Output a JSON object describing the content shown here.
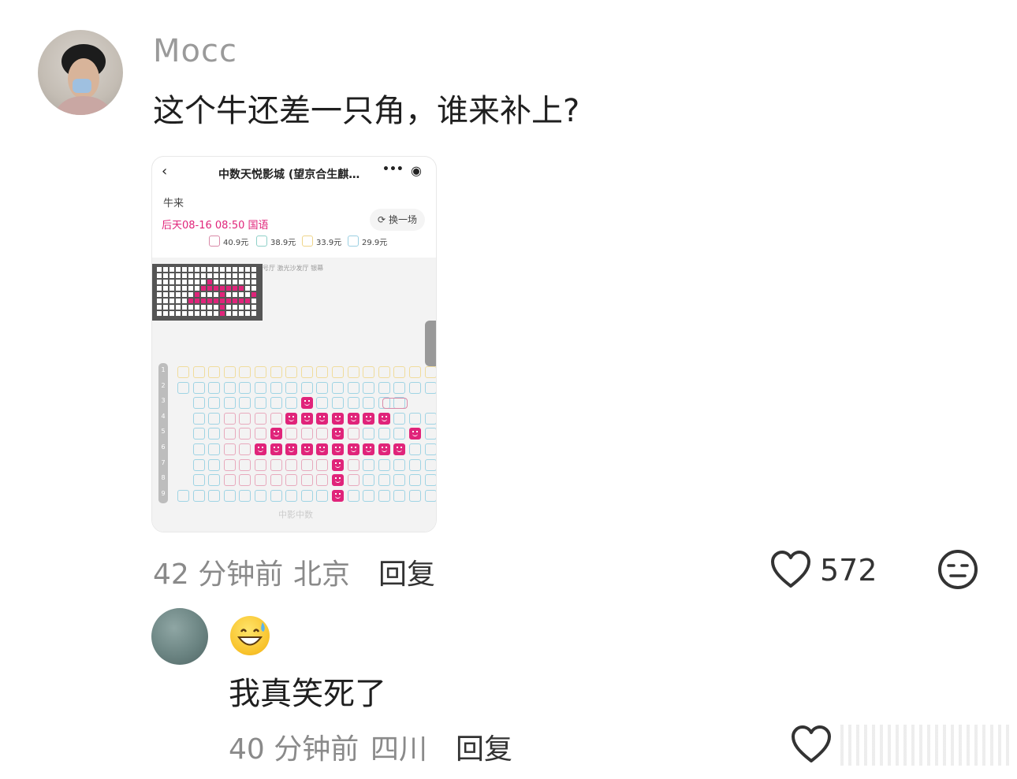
{
  "comment1": {
    "username": "Mocc",
    "text": "这个牛还差一只角，谁来补上?",
    "time": "42 分钟前",
    "location": "北京",
    "reply_label": "回复",
    "like_count": "572",
    "icons": [
      "avatar",
      "heart-icon",
      "meh-face-icon"
    ]
  },
  "screenshot": {
    "nav_title": "中数天悦影城 (望京合生麒…",
    "movie": "牛来",
    "showtime": "后天08-16 08:50 国语",
    "change_label": "换一场",
    "prices": [
      "40.9元",
      "38.9元",
      "33.9元",
      "29.9元"
    ],
    "price_colors": [
      "#d98aa8",
      "#8fd0c8",
      "#efd58a",
      "#9bcfe2"
    ],
    "hall_label": "号厅 激光沙发厅 银幕",
    "watermark": "中影中数",
    "row_numbers": [
      "1",
      "2",
      "3",
      "4",
      "5",
      "6",
      "7",
      "8",
      "9"
    ],
    "selected_color": "#e0247a"
  },
  "comment2": {
    "text": "我真笑死了",
    "time": "40 分钟前",
    "location": "四川",
    "reply_label": "回复",
    "icons": [
      "avatar",
      "grinning-sweat-emoji",
      "heart-icon"
    ]
  }
}
